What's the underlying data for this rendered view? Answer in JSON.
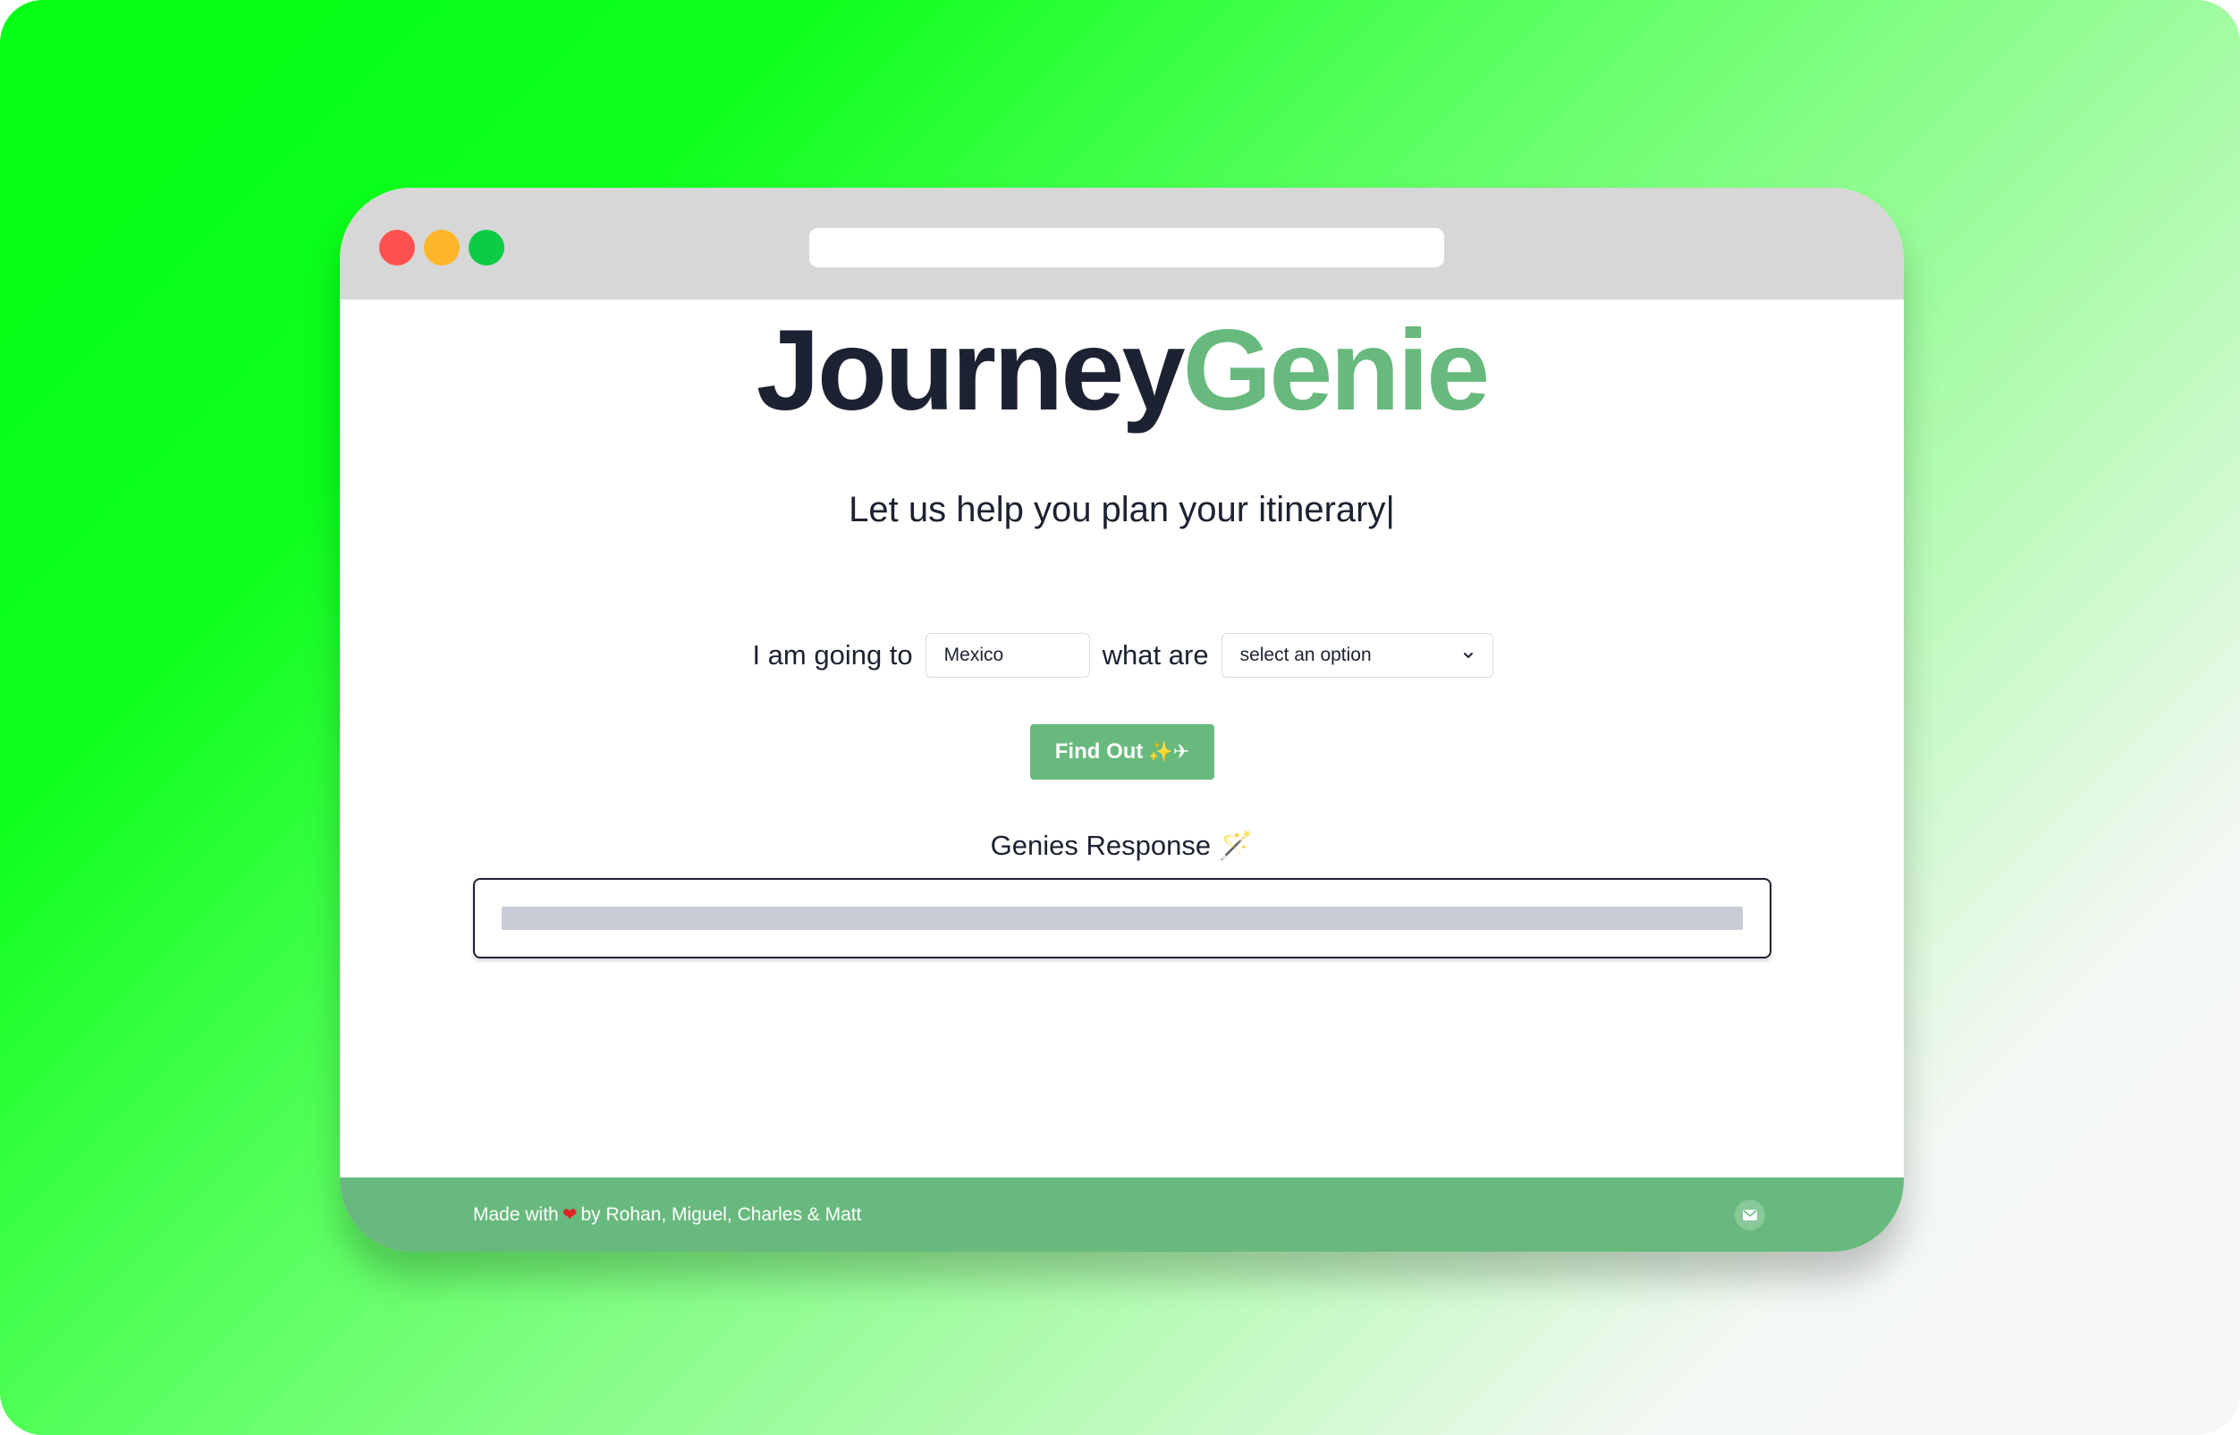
{
  "brand": {
    "part1": "Journey",
    "part2": "Genie"
  },
  "subtitle": "Let us help you plan your itinerary|",
  "form": {
    "label_going": "I am going to",
    "destination_value": "Mexico",
    "label_what": "what are",
    "select_value": "select an option"
  },
  "find_button": {
    "label": "Find Out",
    "emoji": "✨✈"
  },
  "response": {
    "label": "Genies Response 🪄"
  },
  "footer": {
    "text_before": "Made with",
    "heart": "❤",
    "text_after": "by Rohan, Miguel, Charles & Matt"
  },
  "colors": {
    "accent_green": "#68b97d",
    "dark_text": "#1c2231",
    "titlebar": "#d7d7d7",
    "traffic_red": "#ff5250",
    "traffic_yellow": "#ffb628",
    "traffic_green": "#0ccc44",
    "skeleton": "#c8ccd6"
  },
  "icons": {
    "window_controls": [
      "close-dot",
      "minimize-dot",
      "maximize-dot"
    ],
    "select": "chevron-down-icon",
    "footer": "mail-icon"
  }
}
